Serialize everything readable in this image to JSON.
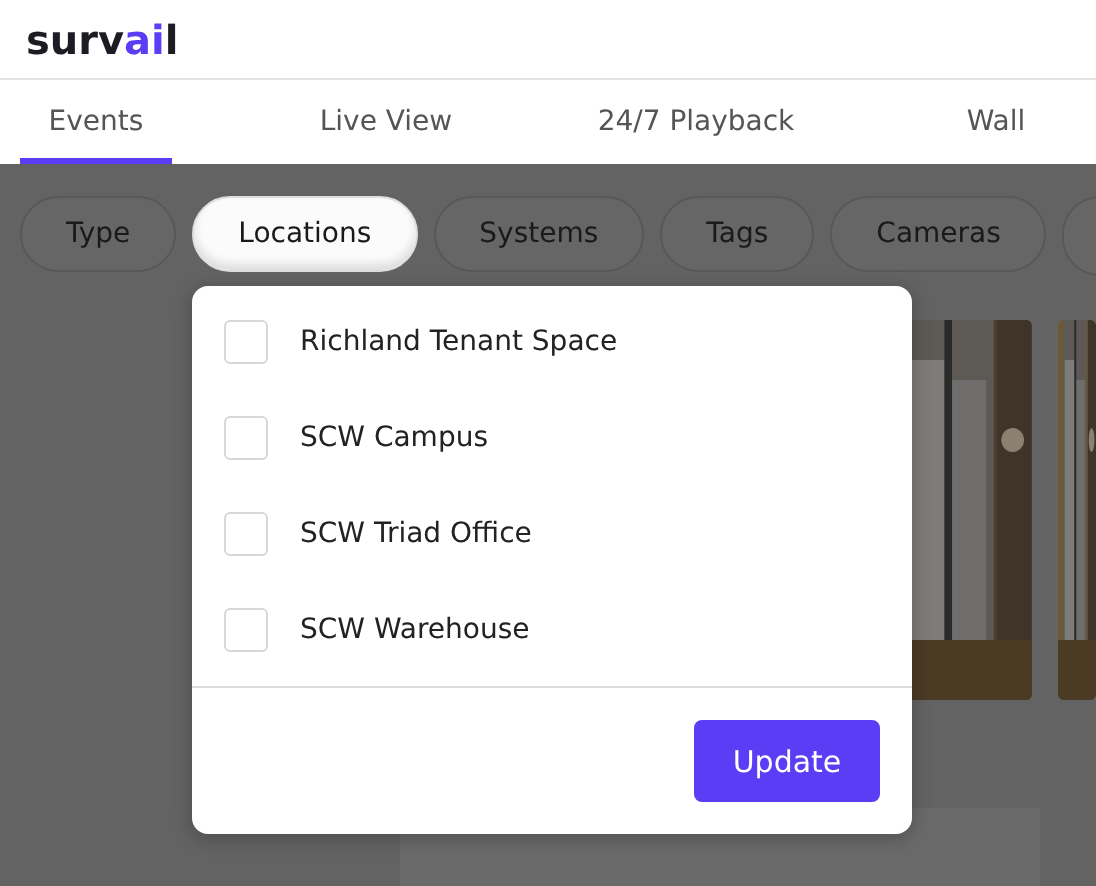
{
  "logo": [
    {
      "text": "surv",
      "accent": false
    },
    {
      "text": "ai",
      "accent": true
    },
    {
      "text": "l",
      "accent": false
    }
  ],
  "tabs": [
    {
      "label": "Events",
      "selected": true
    },
    {
      "label": "Live View",
      "selected": false
    },
    {
      "label": "24/7 Playback",
      "selected": false
    },
    {
      "label": "Wall",
      "selected": false
    }
  ],
  "filters": [
    {
      "label": "Type",
      "selected": false
    },
    {
      "label": "Locations",
      "selected": true
    },
    {
      "label": "Systems",
      "selected": false
    },
    {
      "label": "Tags",
      "selected": false
    },
    {
      "label": "Cameras",
      "selected": false
    }
  ],
  "dropdown": {
    "options": [
      {
        "label": "Richland Tenant Space",
        "checked": false
      },
      {
        "label": "SCW Campus",
        "checked": false
      },
      {
        "label": "SCW Triad Office",
        "checked": false
      },
      {
        "label": "SCW Warehouse",
        "checked": false
      }
    ],
    "button": "Update"
  }
}
